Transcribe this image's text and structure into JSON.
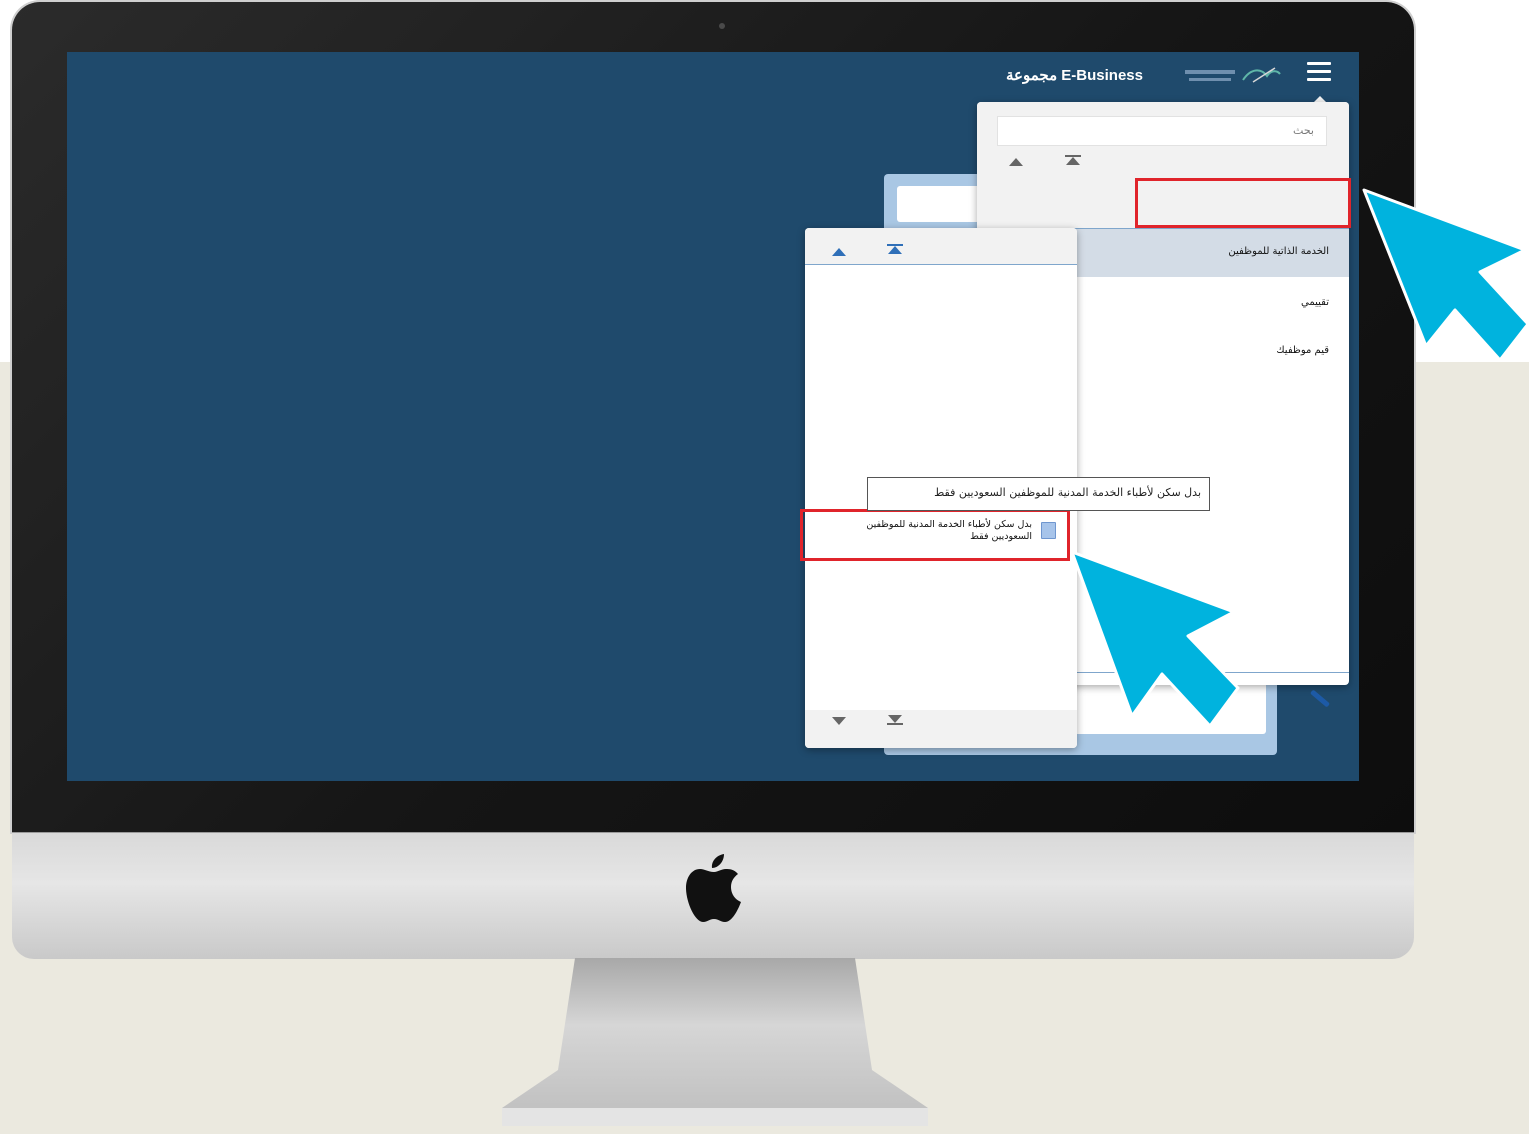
{
  "app": {
    "brand": "E-Business مجموعة"
  },
  "navigator": {
    "search_placeholder": "بحث",
    "items": [
      {
        "label": "الخدمة الذاتية للموظفين",
        "selected": true
      },
      {
        "label": "تقييمي"
      },
      {
        "label": "قيم موظفيك"
      }
    ]
  },
  "submenu": {
    "item_label": "بدل سكن لأطباء الخدمة المدنية للموظفين السعوديين فقط",
    "tooltip": "بدل سكن لأطباء الخدمة المدنية للموظفين السعوديين فقط"
  },
  "colors": {
    "screen_bg": "#1f4a6c",
    "highlight_red": "#e0242b",
    "pointer_cyan": "#00b3de",
    "accent_blue": "#2f6fb8"
  },
  "icons": [
    "menu-icon",
    "scroll-up-icon",
    "scroll-top-icon",
    "scroll-down-icon",
    "scroll-bottom-icon",
    "pencil-icon",
    "document-icon",
    "apple-logo-icon",
    "cursor-arrow-icon"
  ]
}
